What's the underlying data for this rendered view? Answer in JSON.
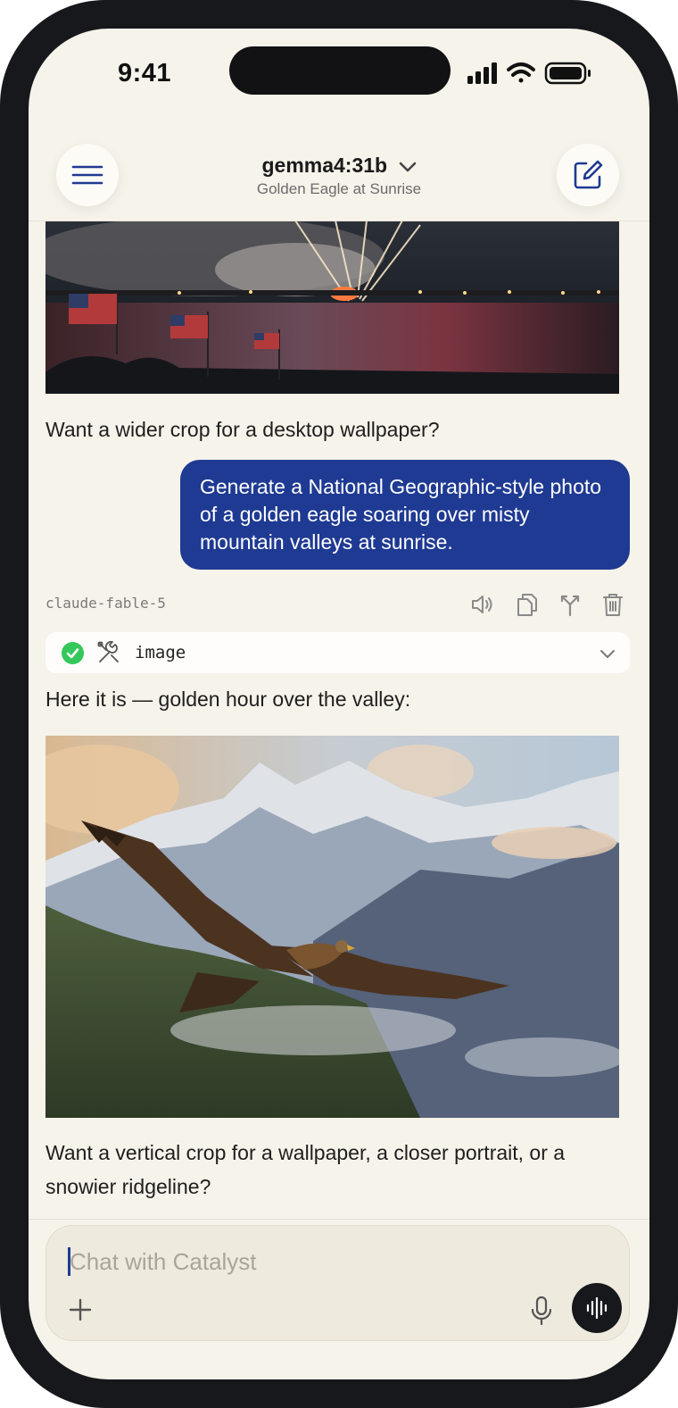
{
  "status_bar": {
    "time": "9:41",
    "icons": [
      "signal-icon",
      "wifi-icon",
      "battery-icon"
    ]
  },
  "header": {
    "model_name": "gemma4:31b",
    "chat_title": "Golden Eagle at Sunrise",
    "menu_icon": "hamburger-icon",
    "compose_icon": "compose-icon"
  },
  "messages": {
    "assistant_followup_1": "Want a wider crop for a desktop wallpaper?",
    "user_prompt": "Generate a National Geographic-style photo of a golden eagle soaring over misty mountain valleys at sunrise.",
    "assistant_model": "claude-fable-5",
    "actions": [
      "speaker-icon",
      "copy-icon",
      "branch-icon",
      "trash-icon"
    ],
    "tool_call": {
      "name": "image",
      "status": "success"
    },
    "assistant_intro": "Here it is — golden hour over the valley:",
    "assistant_followup_2": "Want a vertical crop for a wallpaper, a closer portrait, or a snowier ridgeline?"
  },
  "composer": {
    "placeholder": "Chat with Catalyst"
  },
  "colors": {
    "background": "#f6f3ea",
    "user_bubble": "#1f3a93",
    "success": "#34c759",
    "frame": "#17181c"
  }
}
